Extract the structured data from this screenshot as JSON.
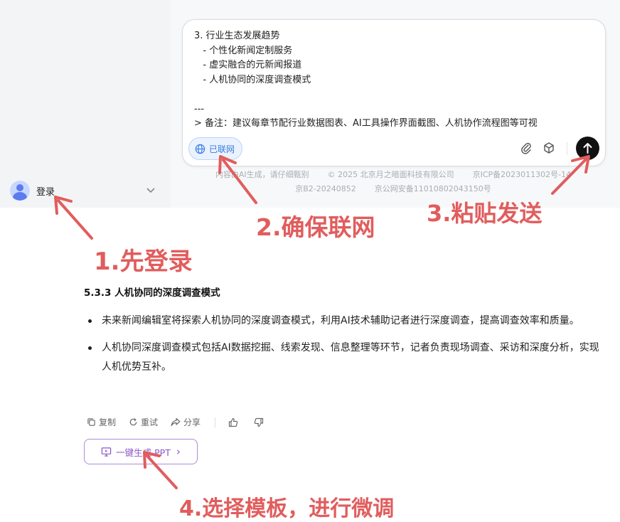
{
  "sidebar": {
    "login_label": "登录"
  },
  "composer": {
    "lines": [
      "3. 行业生态发展趋势",
      "   - 个性化新闻定制服务",
      "   - 虚实融合的元新闻报道",
      "   - 人机协同的深度调查模式",
      "",
      "---",
      "> 备注：建议每章节配行业数据图表、AI工具操作界面截图、人机协作流程图等可视"
    ],
    "network_label": "已联网",
    "icons": [
      "globe-icon",
      "paperclip-icon",
      "cube-icon",
      "send-arrow-icon"
    ]
  },
  "footer": {
    "line1": [
      "内容由AI生成，请仔细甄别",
      "© 2025 北京月之暗面科技有限公司",
      "京ICP备2023011302号-14"
    ],
    "line2": [
      "京B2-20240852",
      "京公网安备11010802043150号"
    ]
  },
  "annotations": {
    "step1": "1.先登录",
    "step2": "2.确保联网",
    "step3": "3.粘贴发送",
    "step4": "4.选择模板，进行微调",
    "color": "#e15d5d"
  },
  "answer": {
    "section_title": "5.3.3 人机协同的深度调查模式",
    "bullets": [
      "未来新闻编辑室将探索人机协同的深度调查模式，利用AI技术辅助记者进行深度调查，提高调查效率和质量。",
      "人机协同深度调查模式包括AI数据挖掘、线索发现、信息整理等环节，记者负责现场调查、采访和深度分析，实现人机优势互补。"
    ]
  },
  "actions": {
    "copy": "复制",
    "retry": "重试",
    "share": "分享"
  },
  "ppt_button": {
    "label": "一键生成 PPT",
    "arrow": "›"
  }
}
